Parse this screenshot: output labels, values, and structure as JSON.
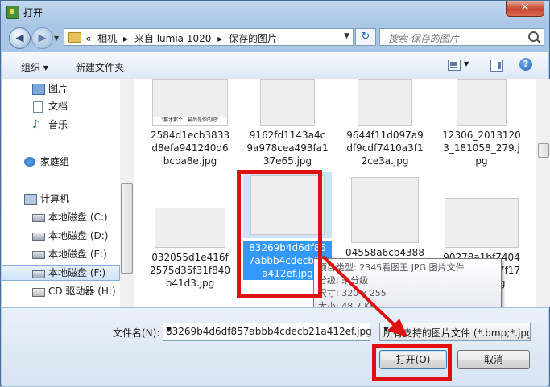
{
  "window": {
    "title": "打开",
    "close_label": "✕"
  },
  "address": {
    "back_label": "◀",
    "forward_label": "▶",
    "breadcrumbs": [
      "«",
      "相机",
      "▸",
      "来自 lumia 1020",
      "▸",
      "保存的图片"
    ],
    "refresh_label": "↻",
    "search_placeholder": "搜索 保存的图片"
  },
  "toolbar": {
    "organize_label": "组织 ▾",
    "new_folder_label": "新建文件夹",
    "help_label": "?"
  },
  "sidebar": {
    "items": [
      {
        "label": "图片",
        "icon": "pictures-icon"
      },
      {
        "label": "文档",
        "icon": "documents-icon"
      },
      {
        "label": "音乐",
        "icon": "music-icon"
      },
      {
        "label": "家庭组",
        "icon": "homegroup-icon"
      },
      {
        "label": "计算机",
        "icon": "computer-icon"
      },
      {
        "label": "本地磁盘 (C:)",
        "icon": "drive-icon"
      },
      {
        "label": "本地磁盘 (D:)",
        "icon": "drive-icon"
      },
      {
        "label": "本地磁盘 (E:)",
        "icon": "drive-icon"
      },
      {
        "label": "本地磁盘 (F:)",
        "icon": "drive-icon",
        "selected": true
      },
      {
        "label": "CD 驱动器 (H:)",
        "icon": "cd-drive-icon"
      }
    ]
  },
  "files": [
    {
      "name": "2584d1ecb3833d8efa941240d6bcba8e.jpg",
      "caption": "\"那才那个，最后是你的吧\""
    },
    {
      "name": "9162fd1143a4c9a978cea493fa137e65.jpg"
    },
    {
      "name": "9644f11d097a9df9cdf7410a3f12ce3a.jpg"
    },
    {
      "name": "12306_20131203_181058_279.jpg"
    },
    {
      "name": "032055d1e416f2575d35f31f840b41d3.jpg"
    },
    {
      "name": "83269b4d6df857abbb4cdecb21a412ef.jpg",
      "selected": true
    },
    {
      "name": "04558a6cb4388e37fa48520898cea131e.jpg"
    },
    {
      "name": "90278a1bf74049f776eaf057f170c1ae.jpg"
    }
  ],
  "tooltip": {
    "type_line": "项目类型: 2345看图王 JPG 图片文件",
    "rating_line": "分级: 未分级",
    "size_dims_line": "尺寸: 320 x 255",
    "filesize_line": "大小: 48.7 KB"
  },
  "bottom": {
    "filename_label": "文件名(N):",
    "filename_value": "83269b4d6df857abbb4cdecb21a412ef.jpg",
    "filetype_value": "所有支持的图片文件 (*.bmp;*.jpg)",
    "open_label": "打开(O)",
    "cancel_label": "取消"
  },
  "colors": {
    "highlight": "#e01010",
    "selection": "#3399ff"
  }
}
